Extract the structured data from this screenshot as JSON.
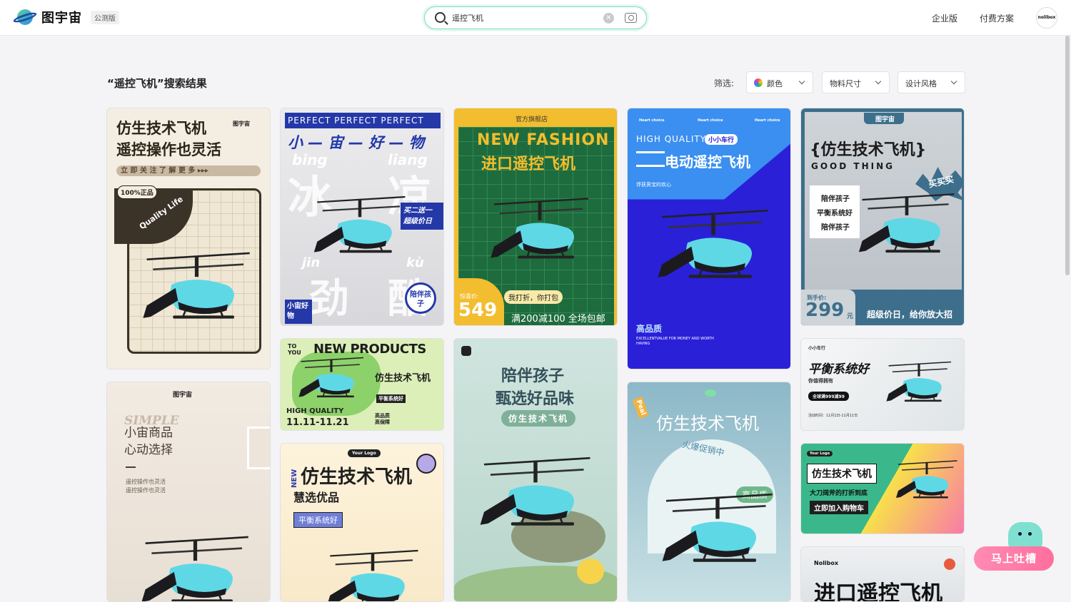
{
  "header": {
    "brand": "图宇宙",
    "badge": "公测版",
    "search_value": "遥控飞机",
    "nav": [
      "企业版",
      "付费方案"
    ],
    "avatar": "nolibox"
  },
  "toolbar": {
    "result_title": "“遥控飞机”搜索结果",
    "filter_label": "筛选:",
    "filters": [
      "颜色",
      "物料尺寸",
      "设计风格"
    ]
  },
  "cards": {
    "c1": {
      "title1": "仿生技术飞机",
      "title2": "遥控操作也灵活",
      "sub": "立 即 关 注    了 解 更 多 ▸▸▸",
      "badge": "100%正品",
      "tag": "Quality Life",
      "logo": "图宇宙"
    },
    "c2": {
      "top": "PERFECT PERFECT PERFECT",
      "title": "小 — 宙 — 好 — 物",
      "w1": "冰",
      "w2": "凉",
      "w3": "劲",
      "w4": "酷",
      "p1": "bing",
      "p2": "liang",
      "p3": "jin",
      "p4": "kù",
      "promo": "买二送一 超级价日",
      "corner": "小宙好物",
      "circle": "陪伴孩子"
    },
    "c3": {
      "shop": "官方旗舰店",
      "title_en": "NEW FASHION",
      "title": "进口遥控飞机",
      "bubble": "我打折，你打包",
      "price_label": "惊喜价:",
      "price": "549",
      "promo": "满200减100 全场包邮"
    },
    "c4": {
      "top": "Heart choice",
      "en": "HIGH QUALITY",
      "tag": "小小车行",
      "title": "电动遥控飞机",
      "sub": "俘获男宝的欢心",
      "q": "高品质",
      "small": "EXCELLENTVALUE FOR MONEY AND WORTH HAVING"
    },
    "c5": {
      "logo": "图宇宙",
      "title": "{仿生技术飞机}",
      "en": "GOOD THING",
      "buy": "买买买",
      "list1": "陪伴孩子",
      "list2": "平衡系统好",
      "list3": "陪伴孩子",
      "price_label": "到手价:",
      "price": "299",
      "unit": "元",
      "promo": "超级价日，给你放大招"
    },
    "c6": {
      "logo": "图宇宙",
      "en": "SIMPLE",
      "title1": "小宙商品",
      "title2": "心动选择",
      "sub1": "遥控操作也灵活",
      "sub2": "遥控操作也灵活"
    },
    "c7": {
      "to": "TO YOU",
      "title": "NEW PRODUCTS",
      "name": "仿生技术飞机",
      "tag": "平衡系统好",
      "en": "HIGH QUALITY",
      "date": "11.11-11.21",
      "q": "高品质 高保障"
    },
    "c8": {
      "logo": "Your Logo",
      "title": "仿生技术飞机",
      "sub": "慧选优品",
      "tag": "平衡系统好",
      "side": "NEW"
    },
    "c9": {
      "title1": "陪伴孩子",
      "title2": "甄选好品味",
      "tag": "仿生技术飞机"
    },
    "c10": {
      "title": "仿生技术飞机",
      "tag": "火爆促销中",
      "q": "高品质",
      "flag": "Peal"
    },
    "c11": {
      "top": "小小车行",
      "title": "平衡系统好",
      "sub": "你值得拥有",
      "pill": "全球满999减99",
      "date": "活动时间：11月1日-11月11日"
    },
    "c12": {
      "logo": "Your Logo",
      "title": "仿生技术飞机",
      "sub": "大刀阔斧的打折到底",
      "cta": "立即加入购物车"
    },
    "c13": {
      "logo": "Nolibox",
      "title": "进口遥控飞机"
    }
  },
  "widgets": {
    "feedback": "马上吐槽"
  },
  "colors": {
    "accent": "#7fd8c6",
    "brand_blue": "#1f4fa8"
  }
}
